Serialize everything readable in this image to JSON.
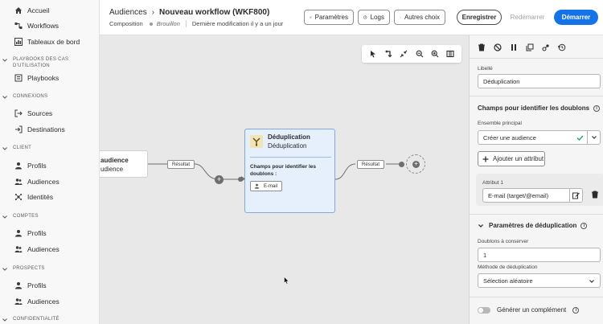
{
  "sidebar": {
    "top_items": [
      {
        "label": "Accueil",
        "icon": "home-icon"
      },
      {
        "label": "Workflows",
        "icon": "workflow-icon"
      },
      {
        "label": "Tableaux de bord",
        "icon": "dashboard-icon"
      }
    ],
    "sections": [
      {
        "title": "PLAYBOOKS DES CAS D'UTILISATION",
        "items": [
          {
            "label": "Playbooks",
            "icon": "playbooks-icon"
          }
        ]
      },
      {
        "title": "CONNEXIONS",
        "items": [
          {
            "label": "Sources",
            "icon": "sources-icon"
          },
          {
            "label": "Destinations",
            "icon": "destinations-icon"
          }
        ]
      },
      {
        "title": "CLIENT",
        "items": [
          {
            "label": "Profils",
            "icon": "person-icon"
          },
          {
            "label": "Audiences",
            "icon": "audiences-icon"
          },
          {
            "label": "Identités",
            "icon": "identities-icon"
          }
        ]
      },
      {
        "title": "COMPTES",
        "items": [
          {
            "label": "Profils",
            "icon": "person-icon"
          },
          {
            "label": "Audiences",
            "icon": "audiences-icon"
          }
        ]
      },
      {
        "title": "PROSPECTS",
        "items": [
          {
            "label": "Profils",
            "icon": "person-icon"
          },
          {
            "label": "Audiences",
            "icon": "audiences-icon"
          }
        ]
      },
      {
        "title": "CONFIDENTIALITÉ",
        "items": []
      }
    ]
  },
  "header": {
    "breadcrumb_parent": "Audiences",
    "breadcrumb_separator": "›",
    "title": "Nouveau workflow (WKF800)",
    "tab": "Composition",
    "status": "Brouillon",
    "last_modified": "Dernière modification il y a un jour",
    "buttons": {
      "parametres": "Paramètres",
      "logs": "Logs",
      "autres_choix": "Autres choix",
      "enregistrer": "Enregistrer",
      "redemarrer": "Redémarrer",
      "demarrer": "Démarrer"
    }
  },
  "canvas": {
    "audience_node": {
      "title": "audience",
      "subtitle": "udience"
    },
    "result_label_1": "Résultat",
    "result_label_2": "Résultat",
    "dedup_node": {
      "title": "Déduplication",
      "subtitle": "Déduplication",
      "fields_label": "Champs pour identifier les doublons :",
      "chip": "E-mail"
    }
  },
  "panel": {
    "libelle_label": "Libellé",
    "libelle_value": "Déduplication",
    "section_doublons": "Champs pour identifier les doublons",
    "ensemble_label": "Ensemble principal",
    "ensemble_value": "Créer une audience",
    "add_attribute": "Ajouter un attribut",
    "attribut_label": "Attribut 1",
    "attribut_value": "E-mail (target/@email)",
    "section_params": "Paramètres de déduplication",
    "doublons_label": "Doublons à conserver",
    "doublons_value": "1",
    "methode_label": "Méthode de déduplication",
    "methode_value": "Sélection aléatoire",
    "generer_label": "Générer un complément"
  },
  "colors": {
    "accent": "#1473e6",
    "node_selected_bg": "#e5f0fc",
    "node_selected_border": "#7fa9e0",
    "check": "#2d9d78"
  }
}
